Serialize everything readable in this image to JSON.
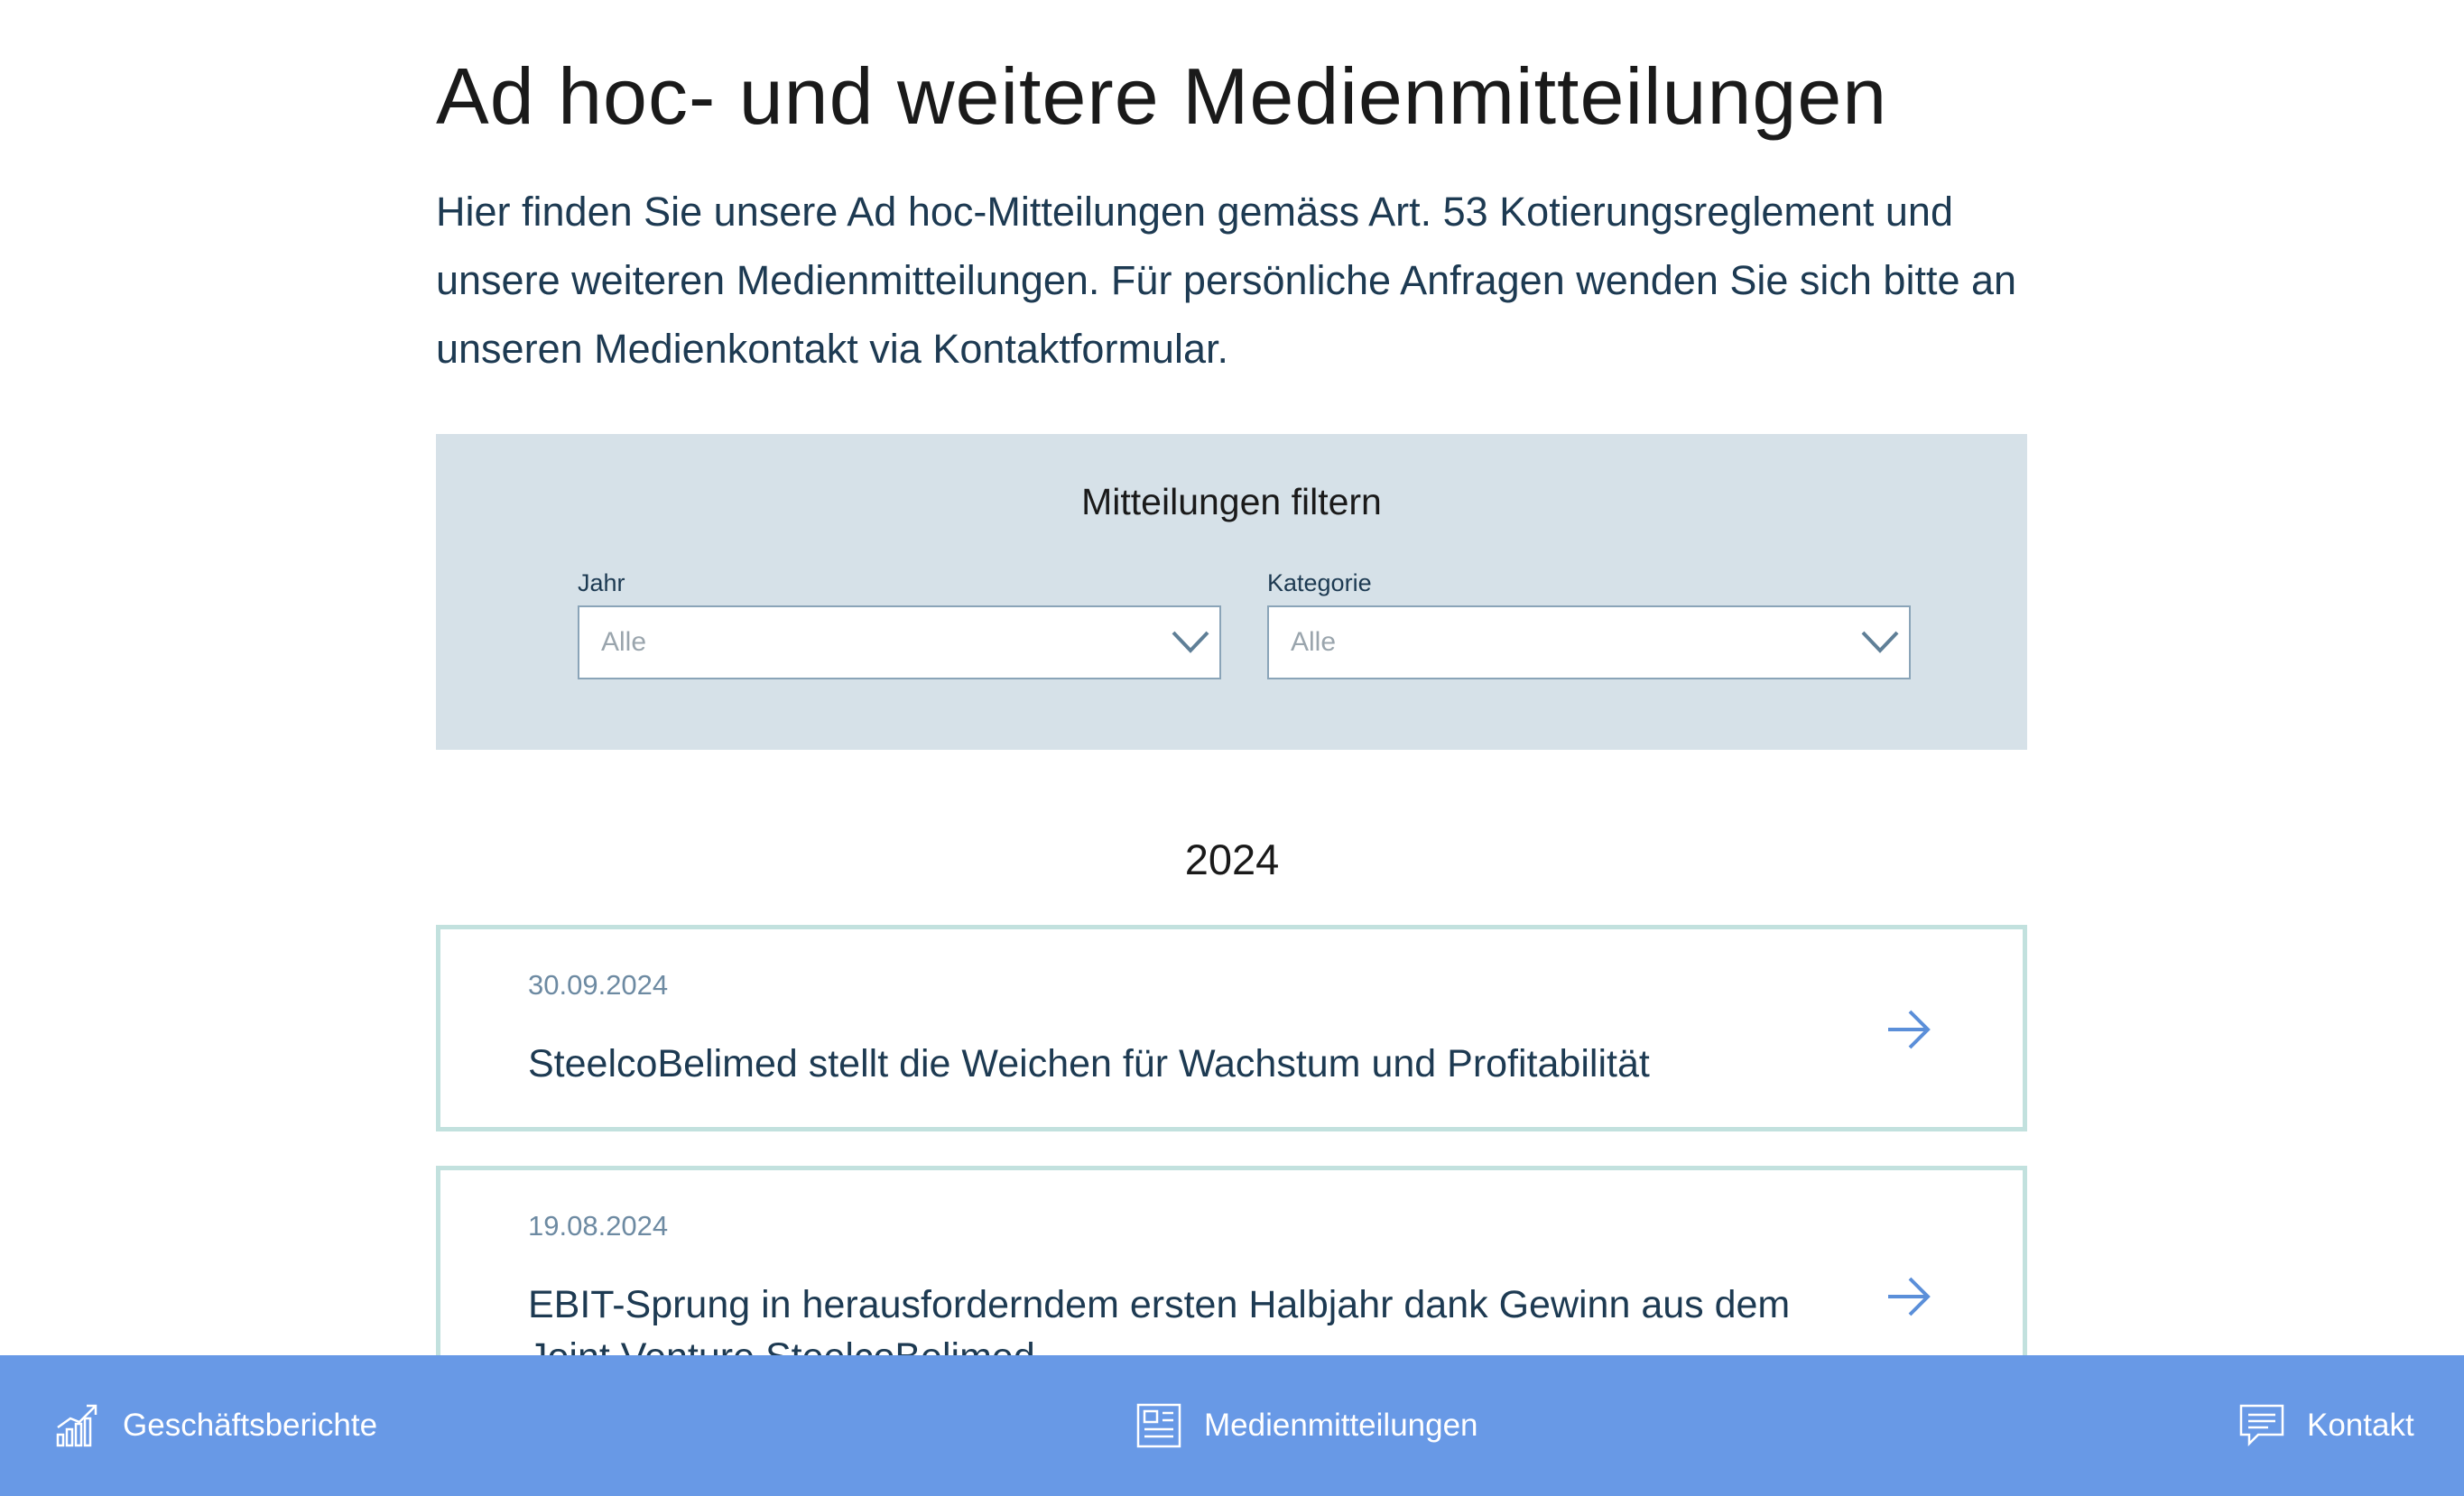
{
  "page": {
    "title": "Ad hoc- und weitere Medienmitteilungen",
    "intro": "Hier finden Sie unsere Ad hoc-Mitteilungen gemäss Art. 53 Kotierungsreglement und unsere weiteren Medienmitteilungen. Für persönliche Anfragen wenden Sie sich bitte an unseren Medienkontakt via Kontaktformular."
  },
  "filter": {
    "heading": "Mitteilungen filtern",
    "year": {
      "label": "Jahr",
      "value": "Alle"
    },
    "category": {
      "label": "Kategorie",
      "value": "Alle"
    }
  },
  "year_group": "2024",
  "releases": [
    {
      "date": "30.09.2024",
      "title": "SteelcoBelimed stellt die Weichen für Wachstum und Profitabilität"
    },
    {
      "date": "19.08.2024",
      "title": "EBIT-Sprung in herausforderndem ersten Halbjahr dank Gewinn aus dem Joint Venture SteelcoBelimed"
    }
  ],
  "bottom_nav": {
    "reports": {
      "label": "Geschäftsberichte",
      "icon": "bar-chart-trend-icon"
    },
    "press": {
      "label": "Medienmitteilungen",
      "icon": "newspaper-icon"
    },
    "contact": {
      "label": "Kontakt",
      "icon": "chat-bubble-icon"
    }
  },
  "colors": {
    "filter_bg": "#d6e1e8",
    "card_border": "#c2e1de",
    "accent": "#6899e6",
    "text_dark": "#1d3a52"
  }
}
